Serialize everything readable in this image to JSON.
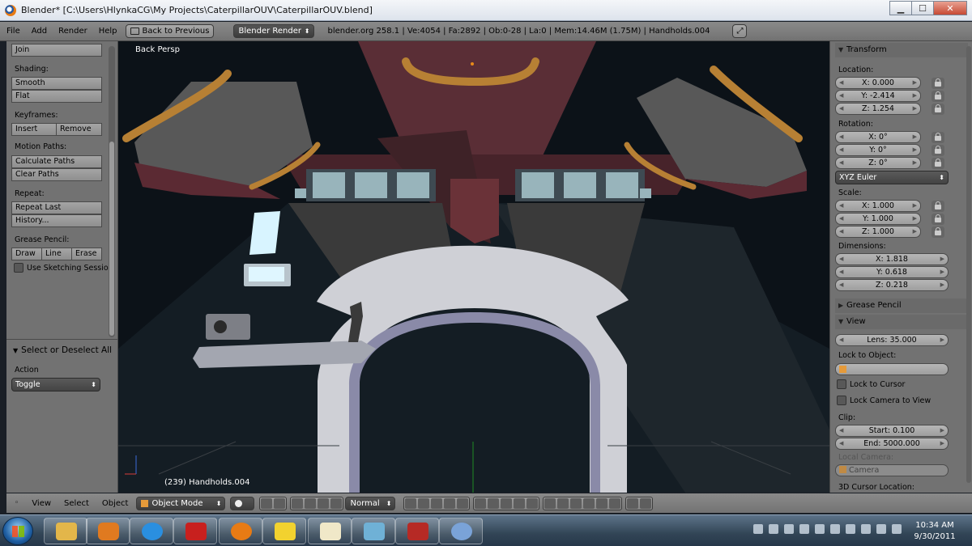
{
  "window": {
    "title": "Blender* [C:\\Users\\HlynkaCG\\My Projects\\CaterpillarOUV\\CaterpillarOUV.blend]",
    "buttons": {
      "minimize": "▁",
      "maximize": "☐",
      "close": "✕"
    }
  },
  "info_header": {
    "menus": [
      "File",
      "Add",
      "Render",
      "Help"
    ],
    "back_button": "Back to Previous",
    "engine": "Blender Render",
    "stats": "blender.org 258.1 | Ve:4054 | Fa:2892 | Ob:0-28 | La:0 | Mem:14.46M (1.75M) | Handholds.004"
  },
  "toolshelf": {
    "join": "Join",
    "shading_label": "Shading:",
    "smooth": "Smooth",
    "flat": "Flat",
    "keyframes_label": "Keyframes:",
    "insert": "Insert",
    "remove": "Remove",
    "motion_paths_label": "Motion Paths:",
    "calculate_paths": "Calculate Paths",
    "clear_paths": "Clear Paths",
    "repeat_label": "Repeat:",
    "repeat_last": "Repeat Last",
    "history": "History...",
    "grease_pencil_label": "Grease Pencil:",
    "draw": "Draw",
    "line": "Line",
    "erase": "Erase",
    "use_sketching": "Use Sketching Sessio",
    "operator_panel": "Select or Deselect All",
    "action_label": "Action",
    "action_value": "Toggle"
  },
  "viewport": {
    "view_name": "Back Persp",
    "object_info": "(239) Handholds.004"
  },
  "properties": {
    "transform": "Transform",
    "location_label": "Location:",
    "loc_x": "X: 0.000",
    "loc_y": "Y: -2.414",
    "loc_z": "Z: 1.254",
    "rotation_label": "Rotation:",
    "rot_x": "X: 0°",
    "rot_y": "Y: 0°",
    "rot_z": "Z: 0°",
    "rotation_mode": "XYZ Euler",
    "scale_label": "Scale:",
    "scale_x": "X: 1.000",
    "scale_y": "Y: 1.000",
    "scale_z": "Z: 1.000",
    "dimensions_label": "Dimensions:",
    "dim_x": "X: 1.818",
    "dim_y": "Y: 0.618",
    "dim_z": "Z: 0.218",
    "grease_pencil": "Grease Pencil",
    "view": "View",
    "lens": "Lens: 35.000",
    "lock_to_object": "Lock to Object:",
    "lock_to_cursor": "Lock to Cursor",
    "lock_camera_to_view": "Lock Camera to View",
    "clip_label": "Clip:",
    "clip_start": "Start: 0.100",
    "clip_end": "End: 5000.000",
    "local_camera_label": "Local Camera:",
    "local_camera": "Camera",
    "cursor_location": "3D Cursor Location:"
  },
  "view3d_header": {
    "menus": [
      "View",
      "Select",
      "Object"
    ],
    "mode": "Object Mode",
    "orientation": "Normal"
  },
  "taskbar": {
    "time": "10:34 AM",
    "date": "9/30/2011",
    "apps": [
      "explorer",
      "media-player",
      "internet-explorer",
      "acrobat",
      "blender",
      "help",
      "presentation",
      "editor",
      "arrow-app",
      "paint"
    ]
  }
}
